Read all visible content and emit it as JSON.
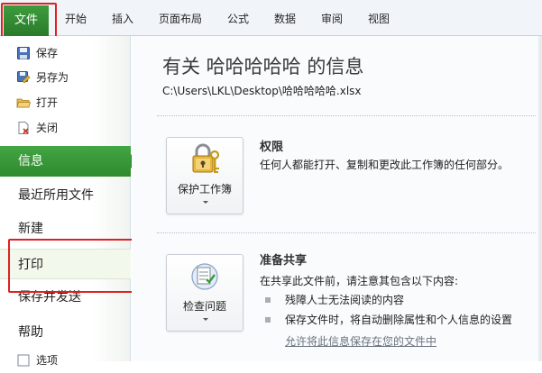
{
  "ribbon": {
    "file_tab": "文件",
    "tabs": [
      "开始",
      "插入",
      "页面布局",
      "公式",
      "数据",
      "审阅",
      "视图"
    ]
  },
  "nav": {
    "commands": [
      {
        "label": "保存",
        "icon": "save-icon"
      },
      {
        "label": "另存为",
        "icon": "save-as-icon"
      },
      {
        "label": "打开",
        "icon": "open-folder-icon"
      },
      {
        "label": "关闭",
        "icon": "close-file-icon"
      }
    ],
    "sections": [
      {
        "label": "信息",
        "active": true
      },
      {
        "label": "最近所用文件"
      },
      {
        "label": "新建"
      },
      {
        "label": "打印",
        "highlighted": true
      },
      {
        "label": "保存并发送"
      },
      {
        "label": "帮助"
      }
    ],
    "cut_off_item": "选项"
  },
  "info": {
    "title": "有关 哈哈哈哈哈 的信息",
    "path": "C:\\Users\\LKL\\Desktop\\哈哈哈哈哈.xlsx",
    "permissions": {
      "button_label": "保护工作簿",
      "heading": "权限",
      "description": "任何人都能打开、复制和更改此工作簿的任何部分。"
    },
    "prepare_share": {
      "button_label": "检查问题",
      "heading": "准备共享",
      "description": "在共享此文件前，请注意其包含以下内容:",
      "bullets": [
        "残障人士无法阅读的内容",
        "保存文件时，将自动删除属性和个人信息的设置"
      ],
      "link": "允许将此信息保存在您的文件中"
    }
  },
  "colors": {
    "accent_green": "#2e8a2e",
    "highlight_red": "#e02020",
    "link_gray": "#6a7480"
  }
}
